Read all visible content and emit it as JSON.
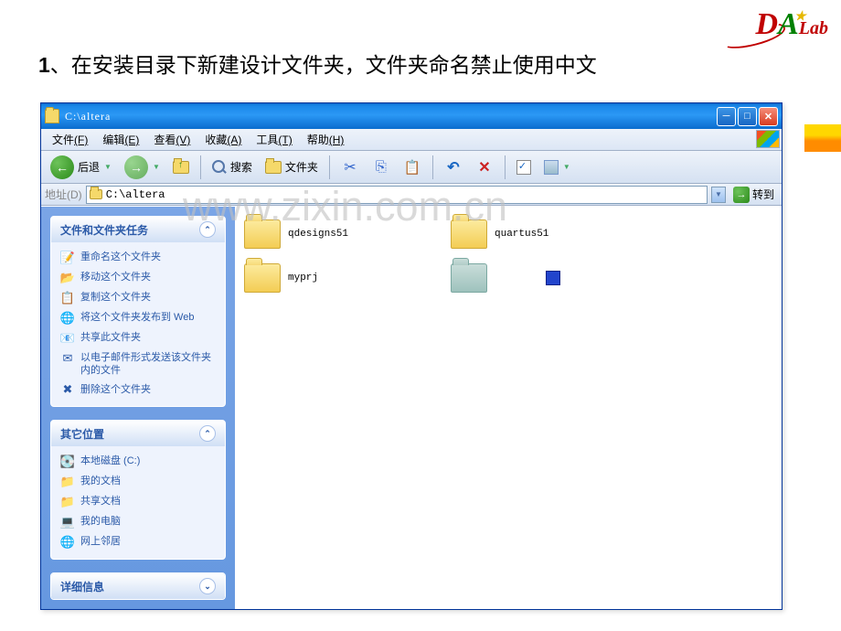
{
  "logo": {
    "d": "D",
    "a": "A",
    "lab": "Lab"
  },
  "heading": {
    "num": "1",
    "text": "、在安装目录下新建设计文件夹，文件夹命名禁止使用中文"
  },
  "watermark": "www.zixin.com.cn",
  "window": {
    "title": "C:\\altera",
    "menu": {
      "file": "文件",
      "file_u": "(F)",
      "edit": "编辑",
      "edit_u": "(E)",
      "view": "查看",
      "view_u": "(V)",
      "fav": "收藏",
      "fav_u": "(A)",
      "tools": "工具",
      "tools_u": "(T)",
      "help": "帮助",
      "help_u": "(H)"
    },
    "toolbar": {
      "back": "后退",
      "search": "搜索",
      "folders": "文件夹"
    },
    "address": {
      "label": "地址",
      "label_u": "(D)",
      "value": "C:\\altera",
      "go": "转到"
    }
  },
  "sidebar": {
    "tasks": {
      "title": "文件和文件夹任务",
      "items": [
        {
          "icon": "📝",
          "label": "重命名这个文件夹"
        },
        {
          "icon": "📂",
          "label": "移动这个文件夹"
        },
        {
          "icon": "📋",
          "label": "复制这个文件夹"
        },
        {
          "icon": "🌐",
          "label": "将这个文件夹发布到 Web"
        },
        {
          "icon": "📧",
          "label": "共享此文件夹"
        },
        {
          "icon": "✉",
          "label": "以电子邮件形式发送该文件夹内的文件"
        },
        {
          "icon": "✖",
          "label": "删除这个文件夹"
        }
      ]
    },
    "places": {
      "title": "其它位置",
      "items": [
        {
          "icon": "💽",
          "label": "本地磁盘 (C:)"
        },
        {
          "icon": "📁",
          "label": "我的文档"
        },
        {
          "icon": "📁",
          "label": "共享文档"
        },
        {
          "icon": "💻",
          "label": "我的电脑"
        },
        {
          "icon": "🌐",
          "label": "网上邻居"
        }
      ]
    },
    "details": {
      "title": "详细信息"
    }
  },
  "content": {
    "items": [
      {
        "type": "folder",
        "label": "qdesigns51"
      },
      {
        "type": "folder",
        "label": "quartus51"
      },
      {
        "type": "folder",
        "label": "myprj"
      },
      {
        "type": "folder-open",
        "label": ""
      },
      {
        "type": "chip",
        "label": ""
      }
    ]
  }
}
